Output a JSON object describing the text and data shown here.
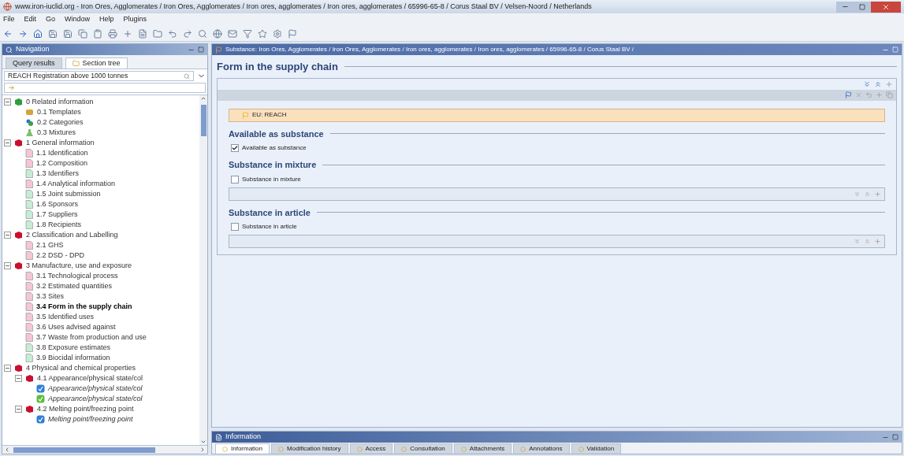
{
  "window": {
    "title": "www.iron-iuclid.org - Iron Ores, Agglomerates / Iron Ores, Agglomerates / Iron ores, agglomerates  / Iron ores, agglomerates  / 65996-65-8 / Corus Staal BV / Velsen-Noord / Netherlands"
  },
  "menu": [
    "File",
    "Edit",
    "Go",
    "Window",
    "Help",
    "Plugins"
  ],
  "navigation": {
    "title": "Navigation",
    "tabs": [
      {
        "label": "Query results",
        "selected": false
      },
      {
        "label": "Section tree",
        "selected": true
      }
    ],
    "template": "REACH Registration above 1000 tonnes",
    "tree": [
      {
        "label": "0 Related information",
        "kind": "chapter",
        "color": "#2e9e3e",
        "expanded": true,
        "selected": false,
        "children": [
          {
            "label": "0.1 Templates",
            "kind": "template",
            "selected": false
          },
          {
            "label": "0.2 Categories",
            "kind": "category",
            "selected": false
          },
          {
            "label": "0.3 Mixtures",
            "kind": "mixture",
            "selected": false
          }
        ]
      },
      {
        "label": "1 General information",
        "kind": "chapter",
        "color": "#c8102e",
        "expanded": true,
        "selected": false,
        "children": [
          {
            "label": "1.1 Identification",
            "kind": "page",
            "color": "#f4c6d6",
            "selected": false
          },
          {
            "label": "1.2 Composition",
            "kind": "page",
            "color": "#f4c6d6",
            "selected": false
          },
          {
            "label": "1.3 Identifiers",
            "kind": "page",
            "color": "#c6ecd6",
            "selected": false
          },
          {
            "label": "1.4 Analytical information",
            "kind": "page",
            "color": "#f4c6d6",
            "selected": false
          },
          {
            "label": "1.5 Joint submission",
            "kind": "page",
            "color": "#c6ecd6",
            "selected": false
          },
          {
            "label": "1.6 Sponsors",
            "kind": "page",
            "color": "#c6ecd6",
            "selected": false
          },
          {
            "label": "1.7 Suppliers",
            "kind": "page",
            "color": "#c6ecd6",
            "selected": false
          },
          {
            "label": "1.8 Recipients",
            "kind": "page",
            "color": "#c6ecd6",
            "selected": false
          }
        ]
      },
      {
        "label": "2 Classification and Labelling",
        "kind": "chapter",
        "color": "#c8102e",
        "expanded": true,
        "selected": false,
        "children": [
          {
            "label": "2.1 GHS",
            "kind": "page",
            "color": "#f4c6d6",
            "selected": false
          },
          {
            "label": "2.2 DSD - DPD",
            "kind": "page",
            "color": "#f4c6d6",
            "selected": false
          }
        ]
      },
      {
        "label": "3 Manufacture, use and exposure",
        "kind": "chapter",
        "color": "#c8102e",
        "expanded": true,
        "selected": false,
        "children": [
          {
            "label": "3.1 Technological process",
            "kind": "page",
            "color": "#f4c6d6",
            "selected": false
          },
          {
            "label": "3.2 Estimated quantities",
            "kind": "page",
            "color": "#f4c6d6",
            "selected": false
          },
          {
            "label": "3.3 Sites",
            "kind": "page",
            "color": "#f4c6d6",
            "selected": false
          },
          {
            "label": "3.4 Form in the supply chain",
            "kind": "page",
            "color": "#f4c6d6",
            "selected": true
          },
          {
            "label": "3.5 Identified uses",
            "kind": "page",
            "color": "#f4c6d6",
            "selected": false
          },
          {
            "label": "3.6 Uses advised against",
            "kind": "page",
            "color": "#f4c6d6",
            "selected": false
          },
          {
            "label": "3.7 Waste from production and use",
            "kind": "page",
            "color": "#f4c6d6",
            "selected": false
          },
          {
            "label": "3.8 Exposure estimates",
            "kind": "page",
            "color": "#c6ecd6",
            "selected": false
          },
          {
            "label": "3.9 Biocidal information",
            "kind": "page",
            "color": "#c6ecd6",
            "selected": false
          }
        ]
      },
      {
        "label": "4 Physical and chemical properties",
        "kind": "chapter",
        "color": "#c8102e",
        "expanded": true,
        "selected": false,
        "children": [
          {
            "label": "4.1 Appearance/physical state/col",
            "kind": "chapter",
            "color": "#c8102e",
            "expanded": true,
            "selected": false,
            "children": [
              {
                "label": "Appearance/physical state/col",
                "kind": "record",
                "color": "#2f7fd6",
                "selected": false
              },
              {
                "label": "Appearance/physical state/col",
                "kind": "record",
                "color": "#5cbf3a",
                "selected": false
              }
            ]
          },
          {
            "label": "4.2 Melting point/freezing point",
            "kind": "chapter",
            "color": "#c8102e",
            "expanded": true,
            "selected": false,
            "children": [
              {
                "label": "Melting point/freezing point",
                "kind": "record",
                "color": "#2f7fd6",
                "selected": false
              }
            ]
          }
        ]
      }
    ]
  },
  "editor": {
    "title": "Substance: Iron Ores, Agglomerates / Iron Ores, Agglomerates / Iron ores, agglomerates  / Iron ores, agglomerates  / 65996-65-8 / Corus Staal BV /",
    "heading": "Form in the supply chain",
    "banner": "EU: REACH",
    "sections": [
      {
        "heading": "Available as substance",
        "kind": "checkbox",
        "checkbox": {
          "label": "Available as substance",
          "checked": true
        }
      },
      {
        "heading": "Substance in mixture",
        "kind": "checkbox-list",
        "checkbox": {
          "label": "Substance in mixture",
          "checked": false
        }
      },
      {
        "heading": "Substance in article",
        "kind": "checkbox-list",
        "checkbox": {
          "label": "Substance in article",
          "checked": false
        }
      }
    ]
  },
  "info_panel": {
    "title": "Information",
    "tabs": [
      {
        "label": "Information",
        "selected": true
      },
      {
        "label": "Modification history",
        "selected": false
      },
      {
        "label": "Access",
        "selected": false
      },
      {
        "label": "Consultation",
        "selected": false
      },
      {
        "label": "Attachments",
        "selected": false
      },
      {
        "label": "Annotations",
        "selected": false
      },
      {
        "label": "Validation",
        "selected": false
      }
    ]
  }
}
